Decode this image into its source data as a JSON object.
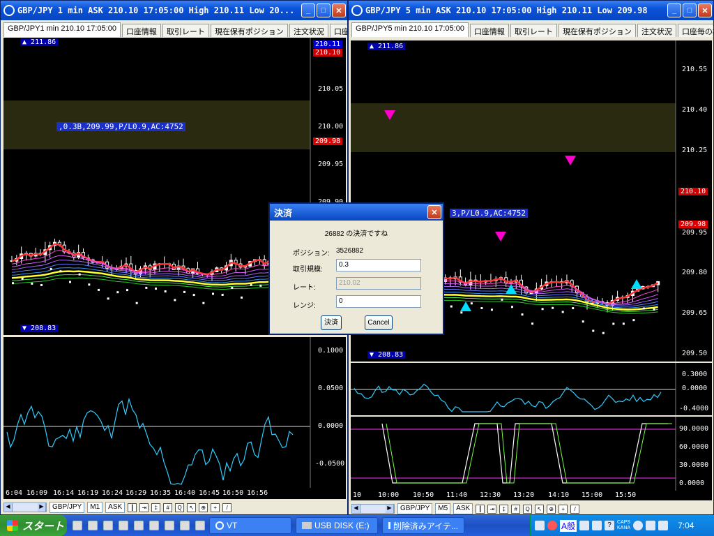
{
  "win1": {
    "title": "GBP/JPY 1 min ASK 210.10 17:05:00 High 210.11 Low 20...",
    "tabs": [
      "GBP/JPY1 min 210.10 17:05:00",
      "口座情報",
      "取引レート",
      "現在保有ポジション",
      "注文状況",
      "口座毎"
    ],
    "price_labels": [
      "210.11",
      "210.10",
      "210.05",
      "210.00",
      "209.98",
      "209.95",
      "209.90"
    ],
    "high_marker": "211.86",
    "low_marker": "208.83",
    "position_label": ",0.3B,209.99,P/L0.9,AC:4752",
    "osc_labels": [
      "0.1000",
      "0.0500",
      "0.0000",
      "-0.0500"
    ],
    "time_labels": [
      "6:04",
      "16:09",
      "16:14",
      "16:19",
      "16:24",
      "16:29",
      "16:35",
      "16:40",
      "16:45",
      "16:50",
      "16:56"
    ],
    "toolbar": {
      "symbol": "GBP/JPY",
      "timeframe": "M1",
      "side": "ASK"
    }
  },
  "win2": {
    "title": "GBP/JPY 5 min ASK 210.10 17:05:00 High 210.11 Low 209.98",
    "tabs": [
      "GBP/JPY5 min 210.10 17:05:00",
      "口座情報",
      "取引レート",
      "現在保有ポジション",
      "注文状況",
      "口座毎の概要"
    ],
    "price_labels": [
      "210.55",
      "210.40",
      "210.25",
      "210.10",
      "209.98",
      "209.95",
      "209.80",
      "209.65",
      "209.50"
    ],
    "high_marker": "211.86",
    "low_marker": "208.83",
    "position_label": "3,P/L0.9,AC:4752",
    "osc_labels": [
      "0.3000",
      "0.0000",
      "-0.4000"
    ],
    "stoch_labels": [
      "90.0000",
      "60.0000",
      "30.0000",
      "0.0000"
    ],
    "time_labels": [
      "10",
      "10:00",
      "10:50",
      "11:40",
      "12:30",
      "13:20",
      "14:10",
      "15:00",
      "15:50"
    ],
    "toolbar": {
      "symbol": "GBP/JPY",
      "timeframe": "M5",
      "side": "ASK"
    }
  },
  "dialog": {
    "title": "決済",
    "message": "26882 の決済ですね",
    "position_label": "ポジション:",
    "position_value": "3526882",
    "lots_label": "取引規模:",
    "lots_value": "0.3",
    "rate_label": "レート:",
    "rate_value": "210.02",
    "range_label": "レンジ:",
    "range_value": "0",
    "ok": "決済",
    "cancel": "Cancel"
  },
  "taskbar": {
    "start": "スタート",
    "tasks": [
      "VT",
      "USB DISK (E:)",
      "削除済みアイテ..."
    ],
    "ime": "A般",
    "clock": "7:04",
    "caps": "CAPS",
    "kana": "KANA"
  },
  "colors": {
    "title": "#0846c2",
    "chart_bg": "#000000",
    "red_label": "#cc0000",
    "blue_label": "#0000cc"
  }
}
